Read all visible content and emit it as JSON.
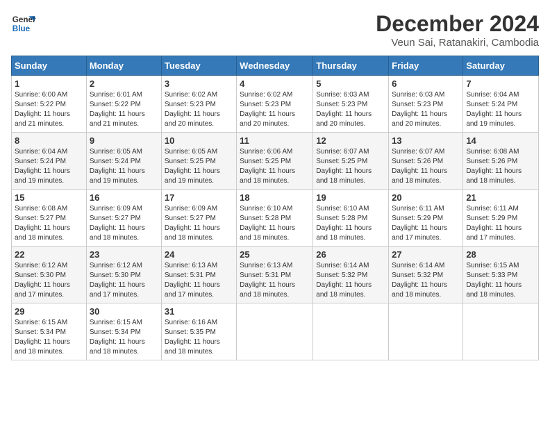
{
  "logo": {
    "line1": "General",
    "line2": "Blue"
  },
  "title": "December 2024",
  "subtitle": "Veun Sai, Ratanakiri, Cambodia",
  "days_of_week": [
    "Sunday",
    "Monday",
    "Tuesday",
    "Wednesday",
    "Thursday",
    "Friday",
    "Saturday"
  ],
  "weeks": [
    [
      {
        "day": "1",
        "info": "Sunrise: 6:00 AM\nSunset: 5:22 PM\nDaylight: 11 hours\nand 21 minutes."
      },
      {
        "day": "2",
        "info": "Sunrise: 6:01 AM\nSunset: 5:22 PM\nDaylight: 11 hours\nand 21 minutes."
      },
      {
        "day": "3",
        "info": "Sunrise: 6:02 AM\nSunset: 5:23 PM\nDaylight: 11 hours\nand 20 minutes."
      },
      {
        "day": "4",
        "info": "Sunrise: 6:02 AM\nSunset: 5:23 PM\nDaylight: 11 hours\nand 20 minutes."
      },
      {
        "day": "5",
        "info": "Sunrise: 6:03 AM\nSunset: 5:23 PM\nDaylight: 11 hours\nand 20 minutes."
      },
      {
        "day": "6",
        "info": "Sunrise: 6:03 AM\nSunset: 5:23 PM\nDaylight: 11 hours\nand 20 minutes."
      },
      {
        "day": "7",
        "info": "Sunrise: 6:04 AM\nSunset: 5:24 PM\nDaylight: 11 hours\nand 19 minutes."
      }
    ],
    [
      {
        "day": "8",
        "info": "Sunrise: 6:04 AM\nSunset: 5:24 PM\nDaylight: 11 hours\nand 19 minutes."
      },
      {
        "day": "9",
        "info": "Sunrise: 6:05 AM\nSunset: 5:24 PM\nDaylight: 11 hours\nand 19 minutes."
      },
      {
        "day": "10",
        "info": "Sunrise: 6:05 AM\nSunset: 5:25 PM\nDaylight: 11 hours\nand 19 minutes."
      },
      {
        "day": "11",
        "info": "Sunrise: 6:06 AM\nSunset: 5:25 PM\nDaylight: 11 hours\nand 18 minutes."
      },
      {
        "day": "12",
        "info": "Sunrise: 6:07 AM\nSunset: 5:25 PM\nDaylight: 11 hours\nand 18 minutes."
      },
      {
        "day": "13",
        "info": "Sunrise: 6:07 AM\nSunset: 5:26 PM\nDaylight: 11 hours\nand 18 minutes."
      },
      {
        "day": "14",
        "info": "Sunrise: 6:08 AM\nSunset: 5:26 PM\nDaylight: 11 hours\nand 18 minutes."
      }
    ],
    [
      {
        "day": "15",
        "info": "Sunrise: 6:08 AM\nSunset: 5:27 PM\nDaylight: 11 hours\nand 18 minutes."
      },
      {
        "day": "16",
        "info": "Sunrise: 6:09 AM\nSunset: 5:27 PM\nDaylight: 11 hours\nand 18 minutes."
      },
      {
        "day": "17",
        "info": "Sunrise: 6:09 AM\nSunset: 5:27 PM\nDaylight: 11 hours\nand 18 minutes."
      },
      {
        "day": "18",
        "info": "Sunrise: 6:10 AM\nSunset: 5:28 PM\nDaylight: 11 hours\nand 18 minutes."
      },
      {
        "day": "19",
        "info": "Sunrise: 6:10 AM\nSunset: 5:28 PM\nDaylight: 11 hours\nand 18 minutes."
      },
      {
        "day": "20",
        "info": "Sunrise: 6:11 AM\nSunset: 5:29 PM\nDaylight: 11 hours\nand 17 minutes."
      },
      {
        "day": "21",
        "info": "Sunrise: 6:11 AM\nSunset: 5:29 PM\nDaylight: 11 hours\nand 17 minutes."
      }
    ],
    [
      {
        "day": "22",
        "info": "Sunrise: 6:12 AM\nSunset: 5:30 PM\nDaylight: 11 hours\nand 17 minutes."
      },
      {
        "day": "23",
        "info": "Sunrise: 6:12 AM\nSunset: 5:30 PM\nDaylight: 11 hours\nand 17 minutes."
      },
      {
        "day": "24",
        "info": "Sunrise: 6:13 AM\nSunset: 5:31 PM\nDaylight: 11 hours\nand 17 minutes."
      },
      {
        "day": "25",
        "info": "Sunrise: 6:13 AM\nSunset: 5:31 PM\nDaylight: 11 hours\nand 18 minutes."
      },
      {
        "day": "26",
        "info": "Sunrise: 6:14 AM\nSunset: 5:32 PM\nDaylight: 11 hours\nand 18 minutes."
      },
      {
        "day": "27",
        "info": "Sunrise: 6:14 AM\nSunset: 5:32 PM\nDaylight: 11 hours\nand 18 minutes."
      },
      {
        "day": "28",
        "info": "Sunrise: 6:15 AM\nSunset: 5:33 PM\nDaylight: 11 hours\nand 18 minutes."
      }
    ],
    [
      {
        "day": "29",
        "info": "Sunrise: 6:15 AM\nSunset: 5:34 PM\nDaylight: 11 hours\nand 18 minutes."
      },
      {
        "day": "30",
        "info": "Sunrise: 6:15 AM\nSunset: 5:34 PM\nDaylight: 11 hours\nand 18 minutes."
      },
      {
        "day": "31",
        "info": "Sunrise: 6:16 AM\nSunset: 5:35 PM\nDaylight: 11 hours\nand 18 minutes."
      },
      {
        "day": "",
        "info": ""
      },
      {
        "day": "",
        "info": ""
      },
      {
        "day": "",
        "info": ""
      },
      {
        "day": "",
        "info": ""
      }
    ]
  ]
}
